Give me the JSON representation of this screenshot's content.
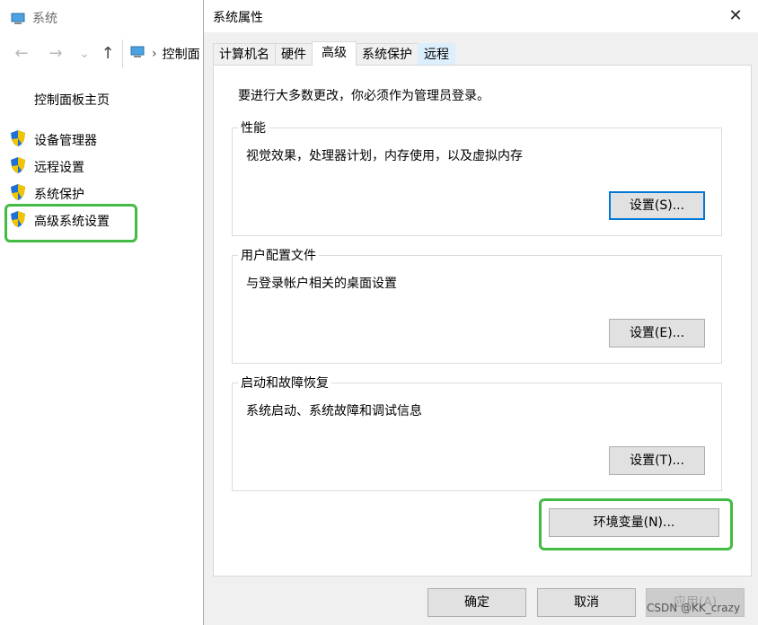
{
  "bg_window": {
    "title": "系统",
    "address_text": "控制面",
    "nav": {
      "back": "←",
      "forward": "→",
      "dropdown": "⌄",
      "up": "↑",
      "sep": "›"
    },
    "home_link": "控制面板主页",
    "links": [
      {
        "label": "设备管理器"
      },
      {
        "label": "远程设置"
      },
      {
        "label": "系统保护"
      },
      {
        "label": "高级系统设置"
      }
    ]
  },
  "dialog": {
    "title": "系统属性",
    "close_glyph": "✕",
    "tabs": [
      "计算机名",
      "硬件",
      "高级",
      "系统保护",
      "远程"
    ],
    "active_tab": "高级",
    "admin_note": "要进行大多数更改，你必须作为管理员登录。",
    "groups": [
      {
        "label": "性能",
        "desc": "视觉效果，处理器计划，内存使用，以及虚拟内存",
        "button": "设置(S)..."
      },
      {
        "label": "用户配置文件",
        "desc": "与登录帐户相关的桌面设置",
        "button": "设置(E)..."
      },
      {
        "label": "启动和故障恢复",
        "desc": "系统启动、系统故障和调试信息",
        "button": "设置(T)..."
      }
    ],
    "env_button": "环境变量(N)...",
    "footer": {
      "ok": "确定",
      "cancel": "取消",
      "apply": "应用(A)"
    }
  },
  "watermark": "CSDN @KK_crazy",
  "colors": {
    "highlight": "#44bb44",
    "focus": "#0078d7",
    "shield_blue": "#1e6fd6",
    "shield_yellow": "#f2c400"
  }
}
